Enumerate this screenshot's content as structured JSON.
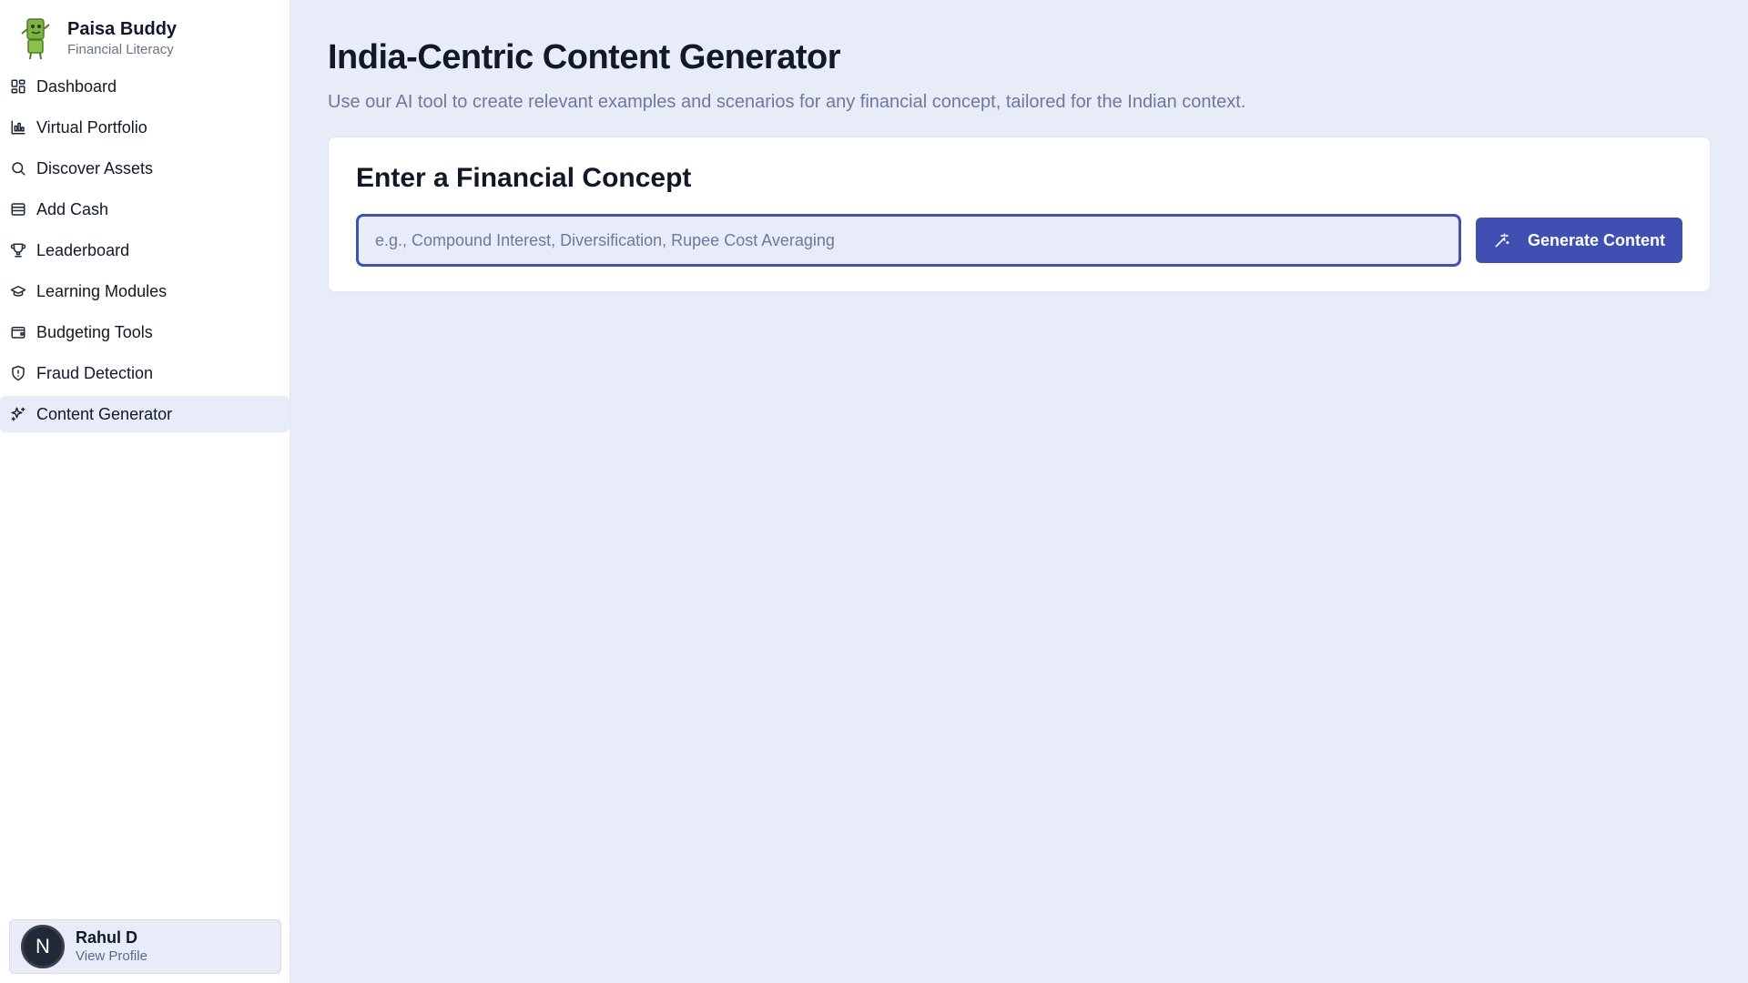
{
  "brand": {
    "name": "Paisa Buddy",
    "subtitle": "Financial Literacy",
    "logo_icon": "money-mascot-icon"
  },
  "sidebar": {
    "items": [
      {
        "label": "Dashboard",
        "icon": "dashboard-grid-icon"
      },
      {
        "label": "Virtual Portfolio",
        "icon": "chart-icon"
      },
      {
        "label": "Discover Assets",
        "icon": "search-icon"
      },
      {
        "label": "Add Cash",
        "icon": "wallet-icon"
      },
      {
        "label": "Leaderboard",
        "icon": "trophy-icon"
      },
      {
        "label": "Learning Modules",
        "icon": "graduation-cap-icon"
      },
      {
        "label": "Budgeting Tools",
        "icon": "wallet-cards-icon"
      },
      {
        "label": "Fraud Detection",
        "icon": "shield-alert-icon"
      },
      {
        "label": "Content Generator",
        "icon": "sparkles-icon",
        "active": true
      }
    ]
  },
  "profile": {
    "initial": "N",
    "name": "Rahul D",
    "link": "View Profile"
  },
  "main": {
    "title": "India-Centric Content Generator",
    "description": "Use our AI tool to create relevant examples and scenarios for any financial concept, tailored for the Indian context.",
    "card": {
      "title": "Enter a Financial Concept",
      "input_placeholder": "e.g., Compound Interest, Diversification, Rupee Cost Averaging",
      "input_value": "",
      "button_label": "Generate Content",
      "button_icon": "magic-wand-icon"
    }
  },
  "colors": {
    "accent": "#3f4fb2",
    "background": "#e8ebf8",
    "sidebar": "#ffffff"
  }
}
